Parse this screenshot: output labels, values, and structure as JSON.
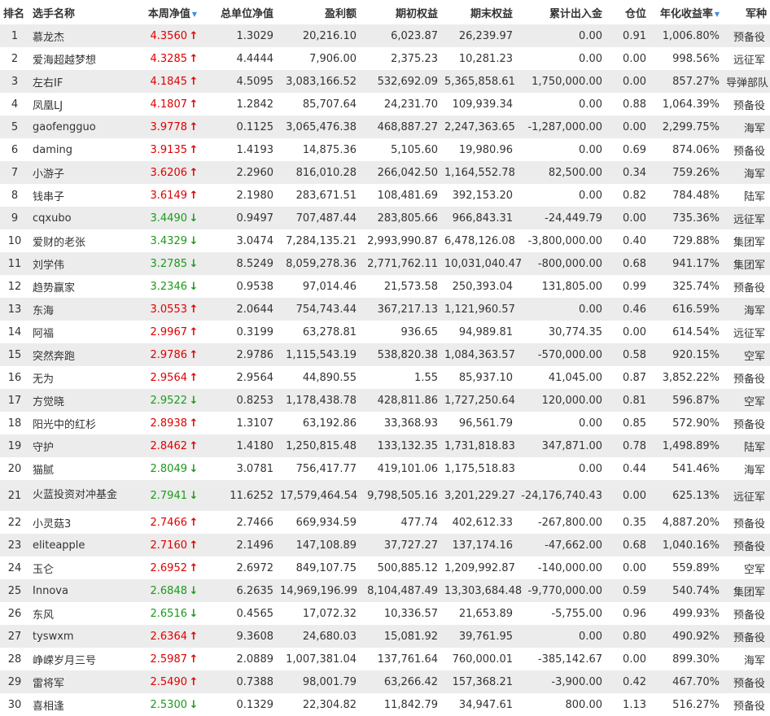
{
  "header": {
    "rank": "排名",
    "name": "选手名称",
    "nav": "本周净值",
    "total_nav": "总单位净值",
    "profit": "盈利额",
    "initial": "期初权益",
    "final": "期末权益",
    "flow": "累计出入金",
    "position": "仓位",
    "annual": "年化收益率",
    "army": "军种",
    "sort_icon": "▼"
  },
  "colors": {
    "up": "#e00000",
    "down": "#1a9b1a",
    "sort": "#3a8ee6",
    "row_alt": "#ececec"
  },
  "rows": [
    {
      "rank": "1",
      "name": "慕龙杰",
      "nav": "4.3560",
      "dir": "up",
      "total": "1.3029",
      "profit": "20,216.10",
      "initial": "6,023.87",
      "final": "26,239.97",
      "flow": "0.00",
      "pos": "0.91",
      "annual": "1,006.80%",
      "army": "预备役"
    },
    {
      "rank": "2",
      "name": "爱海超越梦想",
      "nav": "4.3285",
      "dir": "up",
      "total": "4.4444",
      "profit": "7,906.00",
      "initial": "2,375.23",
      "final": "10,281.23",
      "flow": "0.00",
      "pos": "0.00",
      "annual": "998.56%",
      "army": "远征军"
    },
    {
      "rank": "3",
      "name": "左右IF",
      "nav": "4.1845",
      "dir": "up",
      "total": "4.5095",
      "profit": "3,083,166.52",
      "initial": "532,692.09",
      "final": "5,365,858.61",
      "flow": "1,750,000.00",
      "pos": "0.00",
      "annual": "857.27%",
      "army": "导弹部队"
    },
    {
      "rank": "4",
      "name": "凤凰LJ",
      "nav": "4.1807",
      "dir": "up",
      "total": "1.2842",
      "profit": "85,707.64",
      "initial": "24,231.70",
      "final": "109,939.34",
      "flow": "0.00",
      "pos": "0.88",
      "annual": "1,064.39%",
      "army": "预备役"
    },
    {
      "rank": "5",
      "name": "gaofengguo",
      "nav": "3.9778",
      "dir": "up",
      "total": "0.1125",
      "profit": "3,065,476.38",
      "initial": "468,887.27",
      "final": "2,247,363.65",
      "flow": "-1,287,000.00",
      "pos": "0.00",
      "annual": "2,299.75%",
      "army": "海军"
    },
    {
      "rank": "6",
      "name": "daming",
      "nav": "3.9135",
      "dir": "up",
      "total": "1.4193",
      "profit": "14,875.36",
      "initial": "5,105.60",
      "final": "19,980.96",
      "flow": "0.00",
      "pos": "0.69",
      "annual": "874.06%",
      "army": "预备役"
    },
    {
      "rank": "7",
      "name": "小游子",
      "nav": "3.6206",
      "dir": "up",
      "total": "2.2960",
      "profit": "816,010.28",
      "initial": "266,042.50",
      "final": "1,164,552.78",
      "flow": "82,500.00",
      "pos": "0.34",
      "annual": "759.26%",
      "army": "海军"
    },
    {
      "rank": "8",
      "name": "钱串子",
      "nav": "3.6149",
      "dir": "up",
      "total": "2.1980",
      "profit": "283,671.51",
      "initial": "108,481.69",
      "final": "392,153.20",
      "flow": "0.00",
      "pos": "0.82",
      "annual": "784.48%",
      "army": "陆军"
    },
    {
      "rank": "9",
      "name": "cqxubo",
      "nav": "3.4490",
      "dir": "down",
      "total": "0.9497",
      "profit": "707,487.44",
      "initial": "283,805.66",
      "final": "966,843.31",
      "flow": "-24,449.79",
      "pos": "0.00",
      "annual": "735.36%",
      "army": "远征军"
    },
    {
      "rank": "10",
      "name": "爱财的老张",
      "nav": "3.4329",
      "dir": "down",
      "total": "3.0474",
      "profit": "7,284,135.21",
      "initial": "2,993,990.87",
      "final": "6,478,126.08",
      "flow": "-3,800,000.00",
      "pos": "0.40",
      "annual": "729.88%",
      "army": "集团军"
    },
    {
      "rank": "11",
      "name": "刘学伟",
      "nav": "3.2785",
      "dir": "down",
      "total": "8.5249",
      "profit": "8,059,278.36",
      "initial": "2,771,762.11",
      "final": "10,031,040.47",
      "flow": "-800,000.00",
      "pos": "0.68",
      "annual": "941.17%",
      "army": "集团军"
    },
    {
      "rank": "12",
      "name": "趋势赢家",
      "nav": "3.2346",
      "dir": "down",
      "total": "0.9538",
      "profit": "97,014.46",
      "initial": "21,573.58",
      "final": "250,393.04",
      "flow": "131,805.00",
      "pos": "0.99",
      "annual": "325.74%",
      "army": "预备役"
    },
    {
      "rank": "13",
      "name": "东海",
      "nav": "3.0553",
      "dir": "up",
      "total": "2.0644",
      "profit": "754,743.44",
      "initial": "367,217.13",
      "final": "1,121,960.57",
      "flow": "0.00",
      "pos": "0.46",
      "annual": "616.59%",
      "army": "海军"
    },
    {
      "rank": "14",
      "name": "阿福",
      "nav": "2.9967",
      "dir": "up",
      "total": "0.3199",
      "profit": "63,278.81",
      "initial": "936.65",
      "final": "94,989.81",
      "flow": "30,774.35",
      "pos": "0.00",
      "annual": "614.54%",
      "army": "远征军"
    },
    {
      "rank": "15",
      "name": "突然奔跑",
      "nav": "2.9786",
      "dir": "up",
      "total": "2.9786",
      "profit": "1,115,543.19",
      "initial": "538,820.38",
      "final": "1,084,363.57",
      "flow": "-570,000.00",
      "pos": "0.58",
      "annual": "920.15%",
      "army": "空军"
    },
    {
      "rank": "16",
      "name": "无为",
      "nav": "2.9564",
      "dir": "up",
      "total": "2.9564",
      "profit": "44,890.55",
      "initial": "1.55",
      "final": "85,937.10",
      "flow": "41,045.00",
      "pos": "0.87",
      "annual": "3,852.22%",
      "army": "预备役"
    },
    {
      "rank": "17",
      "name": "方觉晓",
      "nav": "2.9522",
      "dir": "down",
      "total": "0.8253",
      "profit": "1,178,438.78",
      "initial": "428,811.86",
      "final": "1,727,250.64",
      "flow": "120,000.00",
      "pos": "0.81",
      "annual": "596.87%",
      "army": "空军"
    },
    {
      "rank": "18",
      "name": "阳光中的红杉",
      "nav": "2.8938",
      "dir": "up",
      "total": "1.3107",
      "profit": "63,192.86",
      "initial": "33,368.93",
      "final": "96,561.79",
      "flow": "0.00",
      "pos": "0.85",
      "annual": "572.90%",
      "army": "预备役"
    },
    {
      "rank": "19",
      "name": "守护",
      "nav": "2.8462",
      "dir": "up",
      "total": "1.4180",
      "profit": "1,250,815.48",
      "initial": "133,132.35",
      "final": "1,731,818.83",
      "flow": "347,871.00",
      "pos": "0.78",
      "annual": "1,498.89%",
      "army": "陆军"
    },
    {
      "rank": "20",
      "name": "猫腻",
      "nav": "2.8049",
      "dir": "down",
      "total": "3.0781",
      "profit": "756,417.77",
      "initial": "419,101.06",
      "final": "1,175,518.83",
      "flow": "0.00",
      "pos": "0.44",
      "annual": "541.46%",
      "army": "海军"
    },
    {
      "rank": "21",
      "name": "火蓝投资对冲基金",
      "nav": "2.7941",
      "dir": "down",
      "total": "11.6252",
      "profit": "17,579,464.54",
      "initial": "9,798,505.16",
      "final": "3,201,229.27",
      "flow": "-24,176,740.43",
      "pos": "0.00",
      "annual": "625.13%",
      "army": "远征军",
      "tall": true
    },
    {
      "rank": "22",
      "name": "小灵菇3",
      "nav": "2.7466",
      "dir": "up",
      "total": "2.7466",
      "profit": "669,934.59",
      "initial": "477.74",
      "final": "402,612.33",
      "flow": "-267,800.00",
      "pos": "0.35",
      "annual": "4,887.20%",
      "army": "预备役"
    },
    {
      "rank": "23",
      "name": "eliteapple",
      "nav": "2.7160",
      "dir": "up",
      "total": "2.1496",
      "profit": "147,108.89",
      "initial": "37,727.27",
      "final": "137,174.16",
      "flow": "-47,662.00",
      "pos": "0.68",
      "annual": "1,040.16%",
      "army": "预备役"
    },
    {
      "rank": "24",
      "name": "玉仑",
      "nav": "2.6952",
      "dir": "up",
      "total": "2.6972",
      "profit": "849,107.75",
      "initial": "500,885.12",
      "final": "1,209,992.87",
      "flow": "-140,000.00",
      "pos": "0.00",
      "annual": "559.89%",
      "army": "空军"
    },
    {
      "rank": "25",
      "name": "Innova",
      "nav": "2.6848",
      "dir": "down",
      "total": "6.2635",
      "profit": "14,969,196.99",
      "initial": "8,104,487.49",
      "final": "13,303,684.48",
      "flow": "-9,770,000.00",
      "pos": "0.59",
      "annual": "540.74%",
      "army": "集团军"
    },
    {
      "rank": "26",
      "name": "东风",
      "nav": "2.6516",
      "dir": "down",
      "total": "0.4565",
      "profit": "17,072.32",
      "initial": "10,336.57",
      "final": "21,653.89",
      "flow": "-5,755.00",
      "pos": "0.96",
      "annual": "499.93%",
      "army": "预备役"
    },
    {
      "rank": "27",
      "name": "tyswxm",
      "nav": "2.6364",
      "dir": "up",
      "total": "9.3608",
      "profit": "24,680.03",
      "initial": "15,081.92",
      "final": "39,761.95",
      "flow": "0.00",
      "pos": "0.80",
      "annual": "490.92%",
      "army": "预备役"
    },
    {
      "rank": "28",
      "name": "峥嵘岁月三号",
      "nav": "2.5987",
      "dir": "up",
      "total": "2.0889",
      "profit": "1,007,381.04",
      "initial": "137,761.64",
      "final": "760,000.01",
      "flow": "-385,142.67",
      "pos": "0.00",
      "annual": "899.30%",
      "army": "海军"
    },
    {
      "rank": "29",
      "name": "雷将军",
      "nav": "2.5490",
      "dir": "up",
      "total": "0.7388",
      "profit": "98,001.79",
      "initial": "63,266.42",
      "final": "157,368.21",
      "flow": "-3,900.00",
      "pos": "0.42",
      "annual": "467.70%",
      "army": "预备役"
    },
    {
      "rank": "30",
      "name": "喜相逢",
      "nav": "2.5300",
      "dir": "down",
      "total": "0.1329",
      "profit": "22,304.82",
      "initial": "11,842.79",
      "final": "34,947.61",
      "flow": "800.00",
      "pos": "1.13",
      "annual": "516.27%",
      "army": "预备役"
    }
  ]
}
